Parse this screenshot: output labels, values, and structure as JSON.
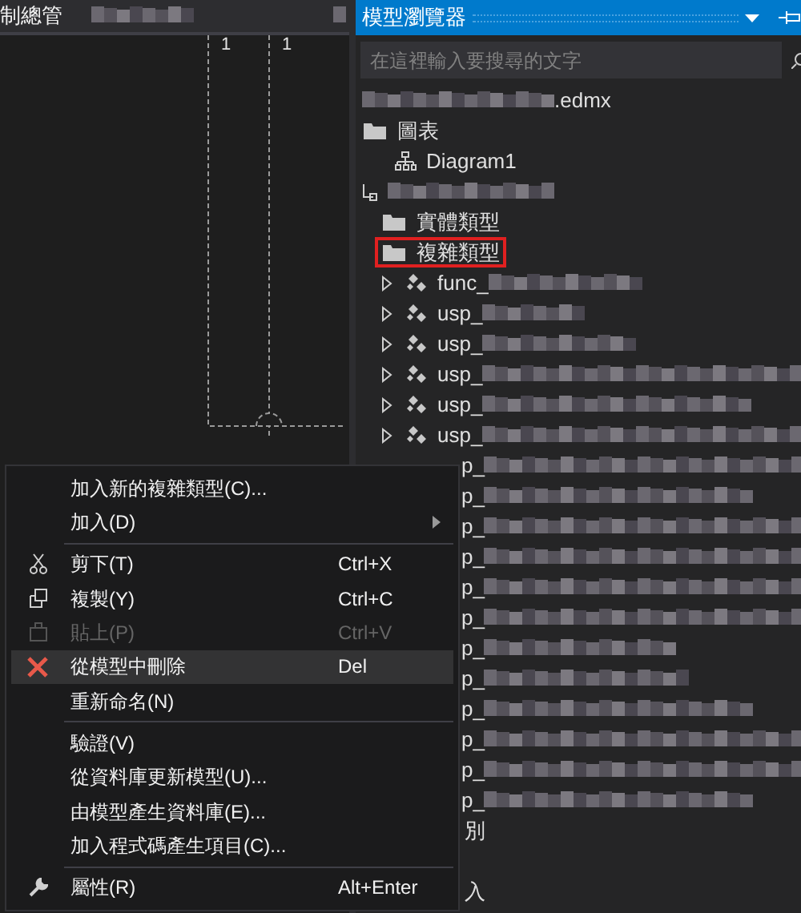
{
  "left_pane": {
    "tab_title": "制總管",
    "connector_labels": [
      "1",
      "1"
    ]
  },
  "model_browser": {
    "title": "模型瀏覽器",
    "search": {
      "placeholder": "在這裡輸入要搜尋的文字"
    },
    "tree": [
      {
        "kind": "file",
        "text": ".edmx",
        "blurred_before": true,
        "blurred_after": false,
        "marked": false
      },
      {
        "kind": "folder-root",
        "text": "圖表",
        "blurred_before": false,
        "blurred_after": false,
        "marked": false
      },
      {
        "kind": "diagram",
        "text": "Diagram1",
        "blurred_before": false,
        "blurred_after": false,
        "marked": false
      },
      {
        "kind": "model",
        "blurred_before": true,
        "blurred_after": false,
        "marked": false
      },
      {
        "kind": "folder",
        "text": "實體類型",
        "blurred_before": false,
        "blurred_after": false,
        "marked": false
      },
      {
        "kind": "folder",
        "text": "複雜類型",
        "blurred_before": false,
        "blurred_after": false,
        "marked": true
      },
      {
        "kind": "complex",
        "text": "func_",
        "blurred_before": false,
        "blurred_after": true,
        "marked": false
      },
      {
        "kind": "complex",
        "text": "usp_",
        "blurred_before": false,
        "blurred_after": true,
        "marked": false
      },
      {
        "kind": "complex",
        "text": "usp_",
        "blurred_before": false,
        "blurred_after": true,
        "marked": false
      },
      {
        "kind": "complex",
        "text": "usp_",
        "blurred_before": false,
        "blurred_after": true,
        "marked": false
      },
      {
        "kind": "complex",
        "text": "usp_",
        "blurred_before": false,
        "blurred_after": true,
        "marked": false
      },
      {
        "kind": "complex",
        "text": "usp_",
        "blurred_before": false,
        "blurred_after": true,
        "marked": false
      },
      {
        "kind": "partial",
        "text": "p_",
        "blurred_before": false,
        "blurred_after": true,
        "marked": false
      },
      {
        "kind": "partial",
        "text": "p_",
        "blurred_before": false,
        "blurred_after": true,
        "marked": false
      },
      {
        "kind": "partial",
        "text": "p_",
        "blurred_before": false,
        "blurred_after": true,
        "marked": false
      },
      {
        "kind": "partial",
        "text": "p_",
        "blurred_before": false,
        "blurred_after": true,
        "marked": false
      },
      {
        "kind": "partial",
        "text": "p_",
        "blurred_before": false,
        "blurred_after": true,
        "marked": false
      },
      {
        "kind": "partial",
        "text": "p_",
        "blurred_before": false,
        "blurred_after": true,
        "marked": false
      },
      {
        "kind": "partial",
        "text": "p_",
        "blurred_before": false,
        "blurred_after": true,
        "marked": false
      },
      {
        "kind": "partial",
        "text": "p_",
        "blurred_before": false,
        "blurred_after": true,
        "marked": false
      },
      {
        "kind": "partial",
        "text": "p_",
        "blurred_before": false,
        "blurred_after": true,
        "marked": false
      },
      {
        "kind": "partial",
        "text": "p_",
        "blurred_before": false,
        "blurred_after": true,
        "marked": false
      },
      {
        "kind": "partial",
        "text": "p_",
        "blurred_before": false,
        "blurred_after": true,
        "marked": false
      },
      {
        "kind": "partial",
        "text": "p_",
        "blurred_before": false,
        "blurred_after": true,
        "marked": false
      },
      {
        "kind": "partial-cut",
        "text": "別",
        "blurred_before": false,
        "blurred_after": false,
        "marked": false
      },
      {
        "kind": "blank"
      },
      {
        "kind": "partial-cut",
        "text": "入",
        "blurred_before": false,
        "blurred_after": false,
        "marked": false
      }
    ]
  },
  "context_menu": [
    {
      "kind": "item",
      "label": "加入新的複雜類型(C)...",
      "disabled": false,
      "selected": false
    },
    {
      "kind": "submenu",
      "label": "加入(D)",
      "disabled": false,
      "selected": false
    },
    {
      "kind": "separator"
    },
    {
      "kind": "item",
      "label": "剪下(T)",
      "shortcut": "Ctrl+X",
      "disabled": false,
      "selected": false
    },
    {
      "kind": "item",
      "label": "複製(Y)",
      "shortcut": "Ctrl+C",
      "disabled": false,
      "selected": false
    },
    {
      "kind": "item",
      "label": "貼上(P)",
      "shortcut": "Ctrl+V",
      "disabled": true,
      "selected": false
    },
    {
      "kind": "item",
      "label": "從模型中刪除",
      "shortcut": "Del",
      "disabled": false,
      "selected": true
    },
    {
      "kind": "item",
      "label": "重新命名(N)",
      "disabled": false,
      "selected": false
    },
    {
      "kind": "separator"
    },
    {
      "kind": "item",
      "label": "驗證(V)",
      "disabled": false,
      "selected": false
    },
    {
      "kind": "item",
      "label": "從資料庫更新模型(U)...",
      "disabled": false,
      "selected": false
    },
    {
      "kind": "item",
      "label": "由模型產生資料庫(E)...",
      "disabled": false,
      "selected": false
    },
    {
      "kind": "item",
      "label": "加入程式碼產生項目(C)...",
      "disabled": false,
      "selected": false
    },
    {
      "kind": "separator"
    },
    {
      "kind": "item",
      "label": "屬性(R)",
      "shortcut": "Alt+Enter",
      "disabled": false,
      "selected": false
    }
  ]
}
